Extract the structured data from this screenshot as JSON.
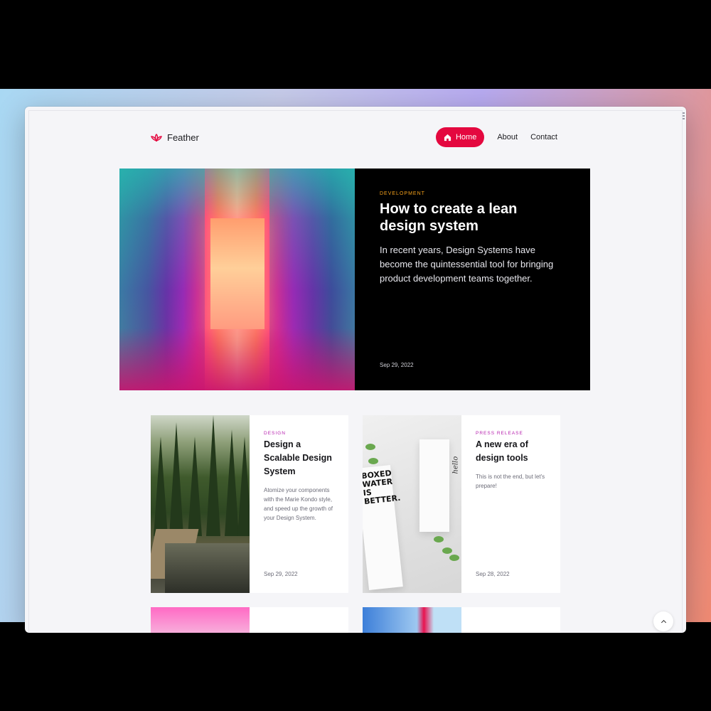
{
  "brand": {
    "name": "Feather",
    "color": "#e4083f"
  },
  "nav": {
    "items": [
      {
        "label": "Home",
        "active": true
      },
      {
        "label": "About"
      },
      {
        "label": "Contact"
      }
    ]
  },
  "hero": {
    "category": "DEVELOPMENT",
    "title": "How to create a lean design system",
    "description": "In recent years, Design Systems have become the quintessential tool for bringing product development teams together.",
    "date": "Sep 29, 2022"
  },
  "cards": [
    {
      "category": "DESIGN",
      "title": "Design a Scalable Design System",
      "description": "Atomize your components with the Marie Kondo style, and speed up the growth of your Design System.",
      "date": "Sep 29, 2022"
    },
    {
      "category": "PRESS RELEASE",
      "title": "A new era of design tools",
      "description": "This is not the end, but let's prepare!",
      "date": "Sep 28, 2022",
      "image_text": [
        "BOXED",
        "WATER",
        "IS",
        "BETTER."
      ],
      "image_text_2": "hello"
    }
  ],
  "accent": "#e4083f"
}
